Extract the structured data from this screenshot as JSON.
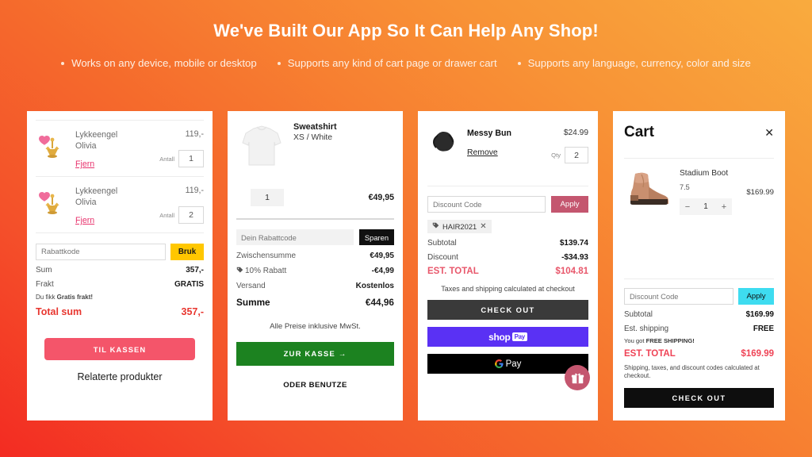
{
  "hero": {
    "title": "We've Built Our App So It Can Help Any Shop!",
    "bullets": [
      "Works on any device, mobile or desktop",
      "Supports any kind of cart page or drawer cart",
      "Supports any language, currency, color and size"
    ]
  },
  "colors": {
    "bg_start": "#f32b22",
    "bg_end": "#f9ab3e",
    "card1_accent": "#f4556a",
    "card1_apply": "#ffc700",
    "card1_total": "#e8362f",
    "card2_checkout": "#1c8220",
    "card3_apply": "#c4566f",
    "card3_total": "#e8576b",
    "shoppay": "#5a31f4",
    "card4_apply": "#3edcf0",
    "card4_total": "#ef4356"
  },
  "card1": {
    "items": [
      {
        "name_line1": "Lykkeengel",
        "name_line2": "Olivia",
        "price": "119,-",
        "remove": "Fjern",
        "qty_label": "Antall",
        "qty": "1",
        "image": "heart-angel-charm-image"
      },
      {
        "name_line1": "Lykkeengel",
        "name_line2": "Olivia",
        "price": "119,-",
        "remove": "Fjern",
        "qty_label": "Antall",
        "qty": "2",
        "image": "heart-angel-charm-image"
      }
    ],
    "discount_placeholder": "Rabattkode",
    "discount_value": "",
    "apply_label": "Bruk",
    "rows": [
      {
        "label": "Sum",
        "value": "357,-"
      },
      {
        "label": "Frakt",
        "value": "GRATIS"
      }
    ],
    "shipping_note_prefix": "Du fikk ",
    "shipping_note_strong": "Gratis frakt!",
    "total_label": "Total sum",
    "total_value": "357,-",
    "checkout_label": "TIL KASSEN",
    "related_label": "Relaterte produkter"
  },
  "card2": {
    "item": {
      "title": "Sweatshirt",
      "variant": "XS / White",
      "qty": "1",
      "price": "€49,95",
      "image": "white-sweatshirt-image"
    },
    "discount_placeholder": "Dein Rabattcode",
    "discount_value": "",
    "apply_label": "Sparen",
    "rows": [
      {
        "label": "Zwischensumme",
        "value": "€49,95",
        "tag": false
      },
      {
        "label": "10% Rabatt",
        "value": "-€4,99",
        "tag": true
      },
      {
        "label": "Versand",
        "value": "Kostenlos",
        "tag": false
      }
    ],
    "total_label": "Summe",
    "total_value": "€44,96",
    "tax_note": "Alle Preise inklusive MwSt.",
    "checkout_label": "ZUR KASSE  →",
    "or_label": "ODER BENUTZE"
  },
  "card3": {
    "item": {
      "name": "Messy Bun",
      "price": "$24.99",
      "remove": "Remove",
      "qty_label": "Qty",
      "qty": "2",
      "image": "messy-bun-hair-image"
    },
    "discount_placeholder": "Discount Code",
    "discount_value": "",
    "apply_label": "Apply",
    "chip_label": "HAIR2021",
    "rows": [
      {
        "label": "Subtotal",
        "value": "$139.74"
      },
      {
        "label": "Discount",
        "value": "-$34.93"
      }
    ],
    "total_label": "EST. TOTAL",
    "total_value": "$104.81",
    "tax_note": "Taxes and shipping calculated at checkout",
    "checkout_label": "CHECK OUT",
    "shoppay_label": "shop",
    "shoppay_pill": "Pay",
    "gpay_label": "Pay",
    "gift_badge": "gift-icon"
  },
  "card4": {
    "title": "Cart",
    "close": "✕",
    "item": {
      "name": "Stadium Boot",
      "variant": "7.5",
      "qty": "1",
      "decrement": "−",
      "increment": "+",
      "price": "$169.99",
      "image": "tan-ankle-boot-image"
    },
    "discount_placeholder": "Discount Code",
    "discount_value": "",
    "apply_label": "Apply",
    "rows": [
      {
        "label": "Subtotal",
        "value": "$169.99"
      },
      {
        "label": "Est. shipping",
        "value": "FREE"
      }
    ],
    "shipping_note_prefix": "You got ",
    "shipping_note_strong": "FREE SHIPPING!",
    "total_label": "EST. TOTAL",
    "total_value": "$169.99",
    "fine_print": "Shipping, taxes, and discount codes calculated at checkout.",
    "checkout_label": "CHECK OUT"
  }
}
